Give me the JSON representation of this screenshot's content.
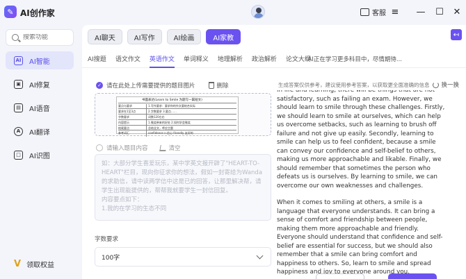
{
  "app": {
    "title": "AI创作家",
    "logo_char": "✎"
  },
  "header": {
    "service_label": "客服",
    "menu_icon": "≡",
    "minimize": "—",
    "maximize": "☐",
    "close": "✕"
  },
  "sidebar": {
    "search_placeholder": "搜索功能",
    "items": [
      {
        "label": "AI智能",
        "icon": "AI",
        "active": true
      },
      {
        "label": "AI修复",
        "icon": "▣",
        "active": false
      },
      {
        "label": "AI语音",
        "icon": "▤",
        "active": false
      },
      {
        "label": "AI翻译",
        "icon": "A",
        "active": false
      },
      {
        "label": "AI识图",
        "icon": "□",
        "active": false
      }
    ],
    "bottom_label": "领取权益"
  },
  "main": {
    "top_tabs": [
      "AI聊天",
      "AI写作",
      "AI绘画",
      "AI家教"
    ],
    "active_top_tab": 3,
    "collapse_icon": "↤",
    "sub_tabs": [
      "AI搜题",
      "语文作文",
      "英语作文",
      "单词释义",
      "地理解析",
      "政治解析",
      "论文大纲"
    ],
    "active_sub_tab": 2,
    "promo": "AI正在学习更多科目中，尽情期待..."
  },
  "left_panel": {
    "upload_label": "请在此处上传需要提供的题目图片",
    "delete_label": "删除",
    "doc_title": "书面表达(Learn to Smile 为题写一篇短文)",
    "doc_rows": [
      [
        "要点与要求",
        "1.写作要求：要求你的作文要结合实际"
      ],
      [
        "要求在1至3点",
        "2.字数要求 3.要点……"
      ],
      [
        "字数要求",
        "词数120左右"
      ],
      [
        "内容提示",
        "1.微笑带来的好处 2.如何学会微笑"
      ],
      [
        "结尾要点",
        "总结全文，呼应主题"
      ],
      [
        "参考词汇",
        "confidence n.信心 friendly 友好的"
      ]
    ],
    "input_label": "请输入题目内容",
    "clear_label": "清空",
    "textarea_placeholder": "如：大部分学生喜爱玩乐，某中学英文报开辟了\"HEART-TO-HEART\"栏目，现向你征求你的想法，假如一封寄给为Wanda的求助信，请中读两学信中这是已的回答，让那里解决帮，请学生出现能提供的，帮帮我就要学生一封信回复。\n内容要点如下：\n1.我的在学习的生态不同",
    "word_count_label": "字数要求",
    "word_count_value": "100字"
  },
  "right_panel": {
    "disclaimer": "生成答案仅供参考，建议使用参考答案，以获取更全面准确的信息",
    "regen_label": "换一换",
    "paragraphs": [
      "in life and learning, there will be things that are not satisfactory, such as failing an exam. However, we should learn to smile through these challenges. Firstly, we should learn to smile at ourselves, which can help us overcome setbacks, such as learning to brush off failure and not give up easily. Secondly, learning to smile can help us to feel confident, because a smile can convey our confidence and self-belief to others, making us more approachable and likable. Finally, we should remember that sometimes the person who defeats us is ourselves. By learning to smile, we can overcome our own weaknesses and challenges.",
      "When it comes to smiling at others, a smile is a language that everyone understands. It can bring a sense of comfort and friendship between people, making them more approachable and friendly. Everyone should understand that confidence and self-belief are essential for success, but we should also remember that a smile can bring comfort and happiness to others. So, learn to smile and spread happiness and joy to everyone around you."
    ]
  }
}
